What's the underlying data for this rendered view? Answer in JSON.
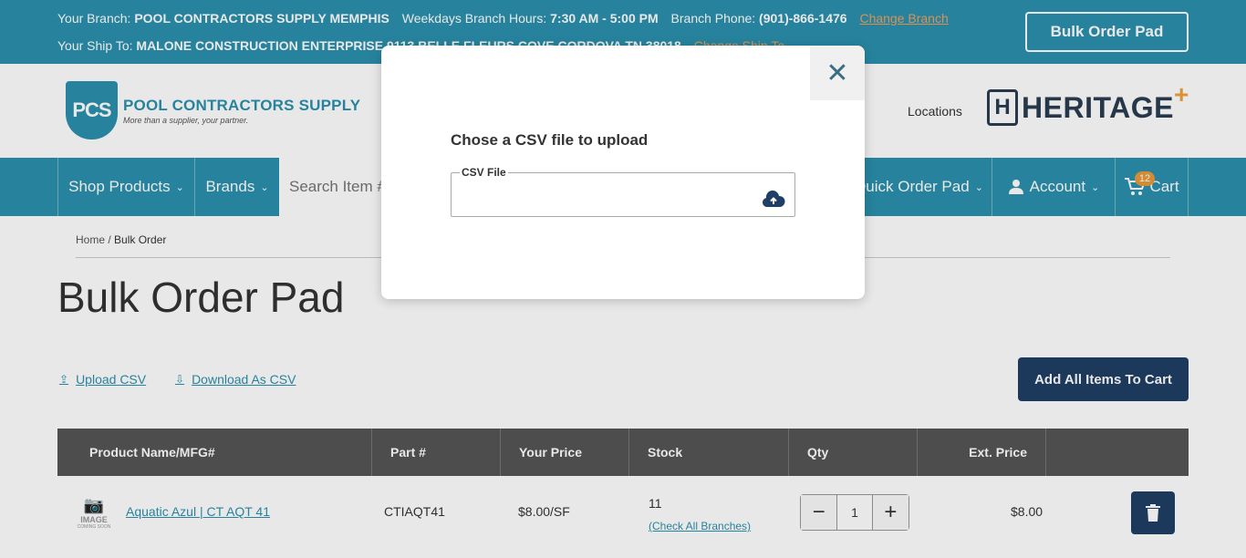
{
  "topbar": {
    "branch_label": "Your Branch:",
    "branch_name": "POOL CONTRACTORS SUPPLY MEMPHIS",
    "hours_label": "Weekdays Branch Hours:",
    "hours": "7:30 AM - 5:00 PM",
    "phone_label": "Branch Phone:",
    "phone": "(901)-866-1476",
    "change_branch": "Change Branch",
    "shipto_label": "Your Ship To:",
    "shipto": "MALONE CONSTRUCTION ENTERPRISE,9113 BELLE FLEURS COVE CORDOVA TN 38018",
    "change_shipto": "Change Ship To",
    "bulk_order_pad": "Bulk Order Pad"
  },
  "header": {
    "logo_abbr": "PCS",
    "logo_name": "POOL CONTRACTORS SUPPLY",
    "logo_tagline": "More than a supplier, your partner.",
    "locations": "Locations",
    "heritage_mark": "H",
    "heritage": "HERITAGE",
    "heritage_plus": "+"
  },
  "nav": {
    "shop_products": "Shop Products",
    "brands": "Brands",
    "search_placeholder": "Search Item #",
    "quick_order_pad": "Quick Order Pad",
    "account": "Account",
    "cart": "Cart",
    "cart_count": "12"
  },
  "breadcrumb": {
    "home": "Home",
    "sep": "/",
    "current": "Bulk Order"
  },
  "page": {
    "title": "Bulk Order Pad",
    "upload_csv": "Upload CSV",
    "download_csv": "Download As CSV",
    "add_all": "Add All Items To Cart"
  },
  "table": {
    "headers": [
      "Product Name/MFG#",
      "Part #",
      "Your Price",
      "Stock",
      "Qty",
      "Ext. Price"
    ],
    "rows": [
      {
        "image_text": "IMAGE",
        "image_sub": "COMING SOON",
        "product": "Aquatic Azul | CT AQT 41",
        "part": "CTIAQT41",
        "price": "$8.00/SF",
        "stock": "11",
        "stock_link": "(Check All Branches)",
        "qty": "1",
        "ext_price": "$8.00"
      }
    ]
  },
  "modal": {
    "title": "Chose a CSV file to upload",
    "field_label": "CSV File"
  },
  "icons": {
    "close": "close-icon",
    "upload": "cloud-upload-icon",
    "trash": "trash-icon",
    "cart": "cart-icon",
    "user": "user-icon"
  },
  "colors": {
    "brand_teal": "#2b91ad",
    "navy": "#1f3f66",
    "accent_orange": "#e89a3a"
  }
}
